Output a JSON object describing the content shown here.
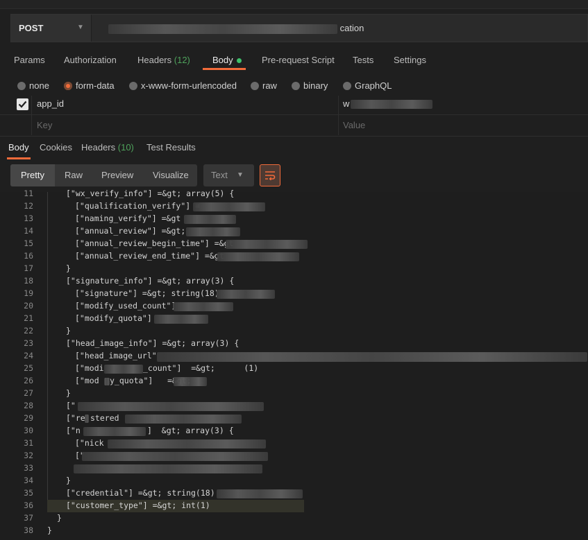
{
  "request": {
    "method": "POST",
    "url_visible_tail": "cation",
    "tabs": [
      {
        "label": "Params"
      },
      {
        "label": "Authorization"
      },
      {
        "label": "Headers",
        "count": "(12)"
      },
      {
        "label": "Body"
      },
      {
        "label": "Pre-request Script"
      },
      {
        "label": "Tests"
      },
      {
        "label": "Settings"
      }
    ],
    "body_types": [
      "none",
      "form-data",
      "x-www-form-urlencoded",
      "raw",
      "binary",
      "GraphQL"
    ],
    "selected_body_type": "form-data",
    "params": [
      {
        "key": "app_id",
        "value": "w",
        "checked": true
      }
    ],
    "key_placeholder": "Key",
    "value_placeholder": "Value"
  },
  "response": {
    "tabs": [
      {
        "label": "Body"
      },
      {
        "label": "Cookies"
      },
      {
        "label": "Headers",
        "count": "(10)"
      },
      {
        "label": "Test Results"
      }
    ],
    "view_modes": [
      "Pretty",
      "Raw",
      "Preview",
      "Visualize"
    ],
    "selected_view": "Pretty",
    "format": "Text",
    "lines": [
      {
        "n": "11",
        "text": "[\"wx_verify_info\"] =&gt; array(5) {"
      },
      {
        "n": "12",
        "text": "[\"qualification_verify\"] ="
      },
      {
        "n": "13",
        "text": "[\"naming_verify\"] =&gt"
      },
      {
        "n": "14",
        "text": "[\"annual_review\"] =&gt;"
      },
      {
        "n": "15",
        "text": "[\"annual_review_begin_time\"] =&gt"
      },
      {
        "n": "16",
        "text": "[\"annual_review_end_time\"] =&gt"
      },
      {
        "n": "17",
        "text": "}"
      },
      {
        "n": "18",
        "text": "[\"signature_info\"] =&gt; array(3) {"
      },
      {
        "n": "19",
        "text": "[\"signature\"] =&gt; string(18)"
      },
      {
        "n": "20",
        "text": "[\"modify_used_count\"]"
      },
      {
        "n": "21",
        "text": "[\"modify_quota\"]"
      },
      {
        "n": "22",
        "text": "}"
      },
      {
        "n": "23",
        "text": "[\"head_image_info\"] =&gt; array(3) {"
      },
      {
        "n": "24",
        "text": "[\"head_image_url\""
      },
      {
        "n": "25",
        "text": "[\"modi"
      },
      {
        "n": "26",
        "text": "[\"mod"
      },
      {
        "n": "27",
        "text": "}"
      },
      {
        "n": "28",
        "text": "[\""
      },
      {
        "n": "29",
        "text": "[\"re"
      },
      {
        "n": "30",
        "text": "[\"n"
      },
      {
        "n": "31",
        "text": "[\"nick"
      },
      {
        "n": "32",
        "text": "[\""
      },
      {
        "n": "33",
        "text": ""
      },
      {
        "n": "34",
        "text": "}"
      },
      {
        "n": "35",
        "text": "[\"credential\"] =&gt; string(18)"
      },
      {
        "n": "36",
        "text": "[\"customer_type\"] =&gt; int(1)"
      },
      {
        "n": "37",
        "text": "}"
      },
      {
        "n": "38",
        "text": "}"
      }
    ],
    "suffixes": {
      "l25": "_count\"]  =&gt;      (1)",
      "l26": "y_quota\"]   =&gt;",
      "l29": "stered",
      "l30": "]  &gt; array(3) {"
    }
  },
  "colors": {
    "accent": "#f26b3a",
    "success": "#4fa35c",
    "dot": "#3ec16b"
  }
}
